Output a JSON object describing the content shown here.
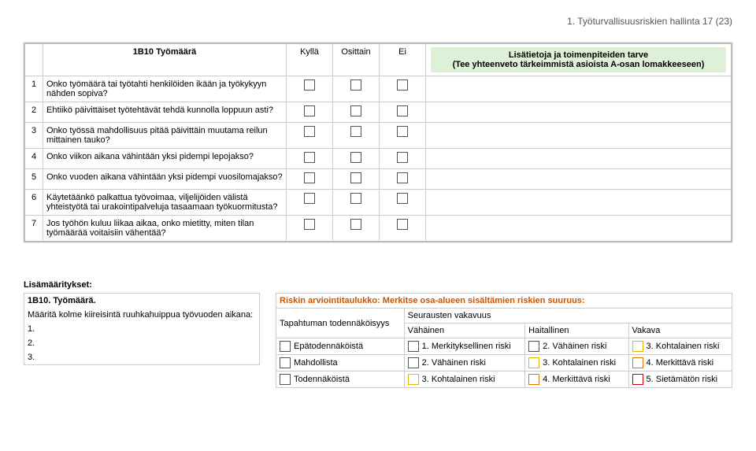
{
  "pageHeader": "1. Työturvallisuusriskien hallinta 17 (23)",
  "mainHeader": {
    "title": "1B10 Työmäärä",
    "cols": [
      "Kyllä",
      "Osittain",
      "Ei"
    ],
    "infoLine1": "Lisätietoja ja toimenpiteiden tarve",
    "infoLine2": "(Tee yhteenveto tärkeimmistä asioista A-osan lomakkeeseen)"
  },
  "questions": [
    {
      "n": "1",
      "q": "Onko työmäärä tai työtahti henkilöiden ikään ja työkykyyn nähden sopiva?"
    },
    {
      "n": "2",
      "q": "Ehtiikö päivittäiset työtehtävät tehdä kunnolla loppuun asti?"
    },
    {
      "n": "3",
      "q": "Onko työssä mahdollisuus pitää päivittäin muutama reilun mittainen tauko?"
    },
    {
      "n": "4",
      "q": "Onko viikon aikana vähintään yksi pidempi lepojakso?"
    },
    {
      "n": "5",
      "q": "Onko vuoden aikana vähintään yksi pidempi vuosilomajakso?"
    },
    {
      "n": "6",
      "q": "Käytetäänkö palkattua työvoimaa, viljelijöiden välistä yhteistyötä tai urakointipalveluja tasaamaan työkuormitusta?"
    },
    {
      "n": "7",
      "q": "Jos työhön kuluu liikaa aikaa, onko mietitty, miten tilan työmäärää voitaisiin vähentää?"
    }
  ],
  "extraHeader": "Lisämääritykset:",
  "leftBox": {
    "title": "1B10. Työmäärä.",
    "instr": "Määritä kolme kiireisintä ruuhkahuippua työvuoden aikana:",
    "rows": [
      "1.",
      "2.",
      "3."
    ]
  },
  "riskTable": {
    "title": "Riskin arviointitaulukko: Merkitse osa-alueen sisältämien riskien suuruus:",
    "probLabel": "Tapahtuman todennäköisyys",
    "sevLabel": "Seurausten vakavuus",
    "sevCols": [
      "Vähäinen",
      "Haitallinen",
      "Vakava"
    ],
    "rows": [
      {
        "prob": "Epätodennäköistä",
        "cells": [
          "1. Merkityksellinen riski",
          "2. Vähäinen riski",
          "3. Kohtalainen riski"
        ],
        "colors": [
          "green",
          "green",
          "yellow"
        ]
      },
      {
        "prob": "Mahdollista",
        "cells": [
          "2. Vähäinen riski",
          "3. Kohtalainen riski",
          "4. Merkittävä riski"
        ],
        "colors": [
          "green",
          "yellow",
          "orange"
        ]
      },
      {
        "prob": "Todennäköistä",
        "cells": [
          "3. Kohtalainen riski",
          "4. Merkittävä riski",
          "5. Sietämätön riski"
        ],
        "colors": [
          "yellow",
          "orange",
          "red"
        ]
      }
    ]
  }
}
